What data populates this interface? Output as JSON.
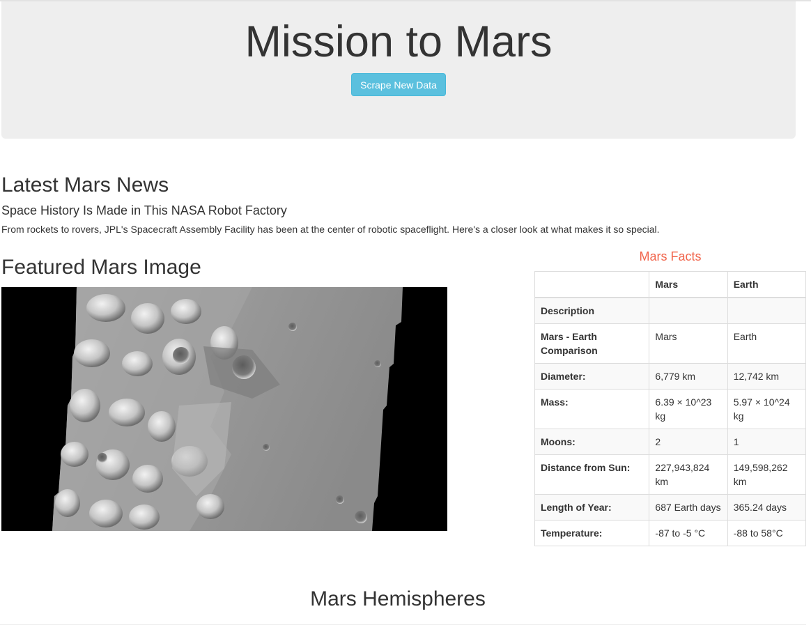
{
  "header": {
    "title": "Mission to Mars",
    "scrape_button_label": "Scrape New Data"
  },
  "news": {
    "section_title": "Latest Mars News",
    "headline": "Space History Is Made in This NASA Robot Factory",
    "paragraph": "From rockets to rovers, JPL's Spacecraft Assembly Facility has been at the center of robotic spaceflight. Here's a closer look at what makes it so special."
  },
  "featured_image": {
    "section_title": "Featured Mars Image"
  },
  "facts": {
    "section_title": "Mars Facts",
    "columns": [
      "",
      "Mars",
      "Earth"
    ],
    "rows": [
      {
        "label": "Description",
        "mars": "",
        "earth": ""
      },
      {
        "label": "Mars - Earth Comparison",
        "mars": "Mars",
        "earth": "Earth"
      },
      {
        "label": "Diameter:",
        "mars": "6,779 km",
        "earth": "12,742 km"
      },
      {
        "label": "Mass:",
        "mars": "6.39 × 10^23 kg",
        "earth": "5.97 × 10^24 kg"
      },
      {
        "label": "Moons:",
        "mars": "2",
        "earth": "1"
      },
      {
        "label": "Distance from Sun:",
        "mars": "227,943,824 km",
        "earth": "149,598,262 km"
      },
      {
        "label": "Length of Year:",
        "mars": "687 Earth days",
        "earth": "365.24 days"
      },
      {
        "label": "Temperature:",
        "mars": "-87 to -5 °C",
        "earth": "-88 to 58°C"
      }
    ]
  },
  "hemispheres": {
    "section_title": "Mars Hemispheres"
  },
  "colors": {
    "jumbotron_bg": "#eeeeee",
    "button_bg": "#5bc0de",
    "facts_title": "#f1654c"
  }
}
